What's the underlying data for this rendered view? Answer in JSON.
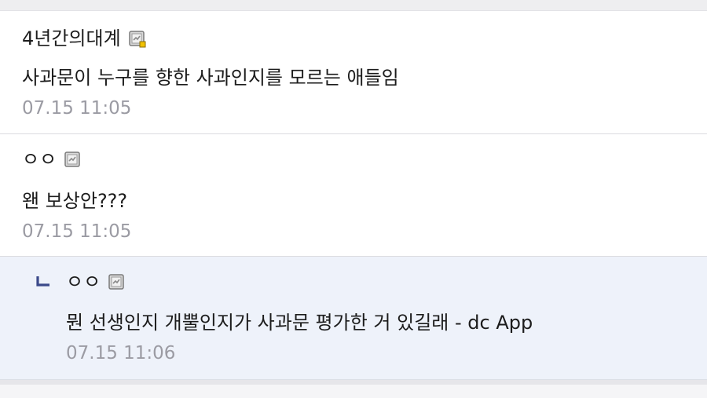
{
  "comments": [
    {
      "nickname": "4년간의대계",
      "badge_icon": "fixed-nick-badge-icon",
      "content": "사과문이 누구를 향한 사과인지를 모르는 애들임",
      "date": "07.15 11:05"
    },
    {
      "nickname": "ㅇㅇ",
      "badge_icon": "fixed-nick-badge-icon",
      "content": "왠 보상안???",
      "date": "07.15 11:05"
    }
  ],
  "reply": {
    "reply_icon": "reply-arrow-icon",
    "nickname": "ㅇㅇ",
    "badge_icon": "fixed-nick-badge-icon",
    "content": "뭔 선생인지 개뿔인지가 사과문 평가한 거 있길래 - dc App",
    "date": "07.15 11:06"
  },
  "colors": {
    "reply_background": "#eef2fa",
    "date_text": "#9b9ba3",
    "reply_mark": "#3b4a8a"
  }
}
